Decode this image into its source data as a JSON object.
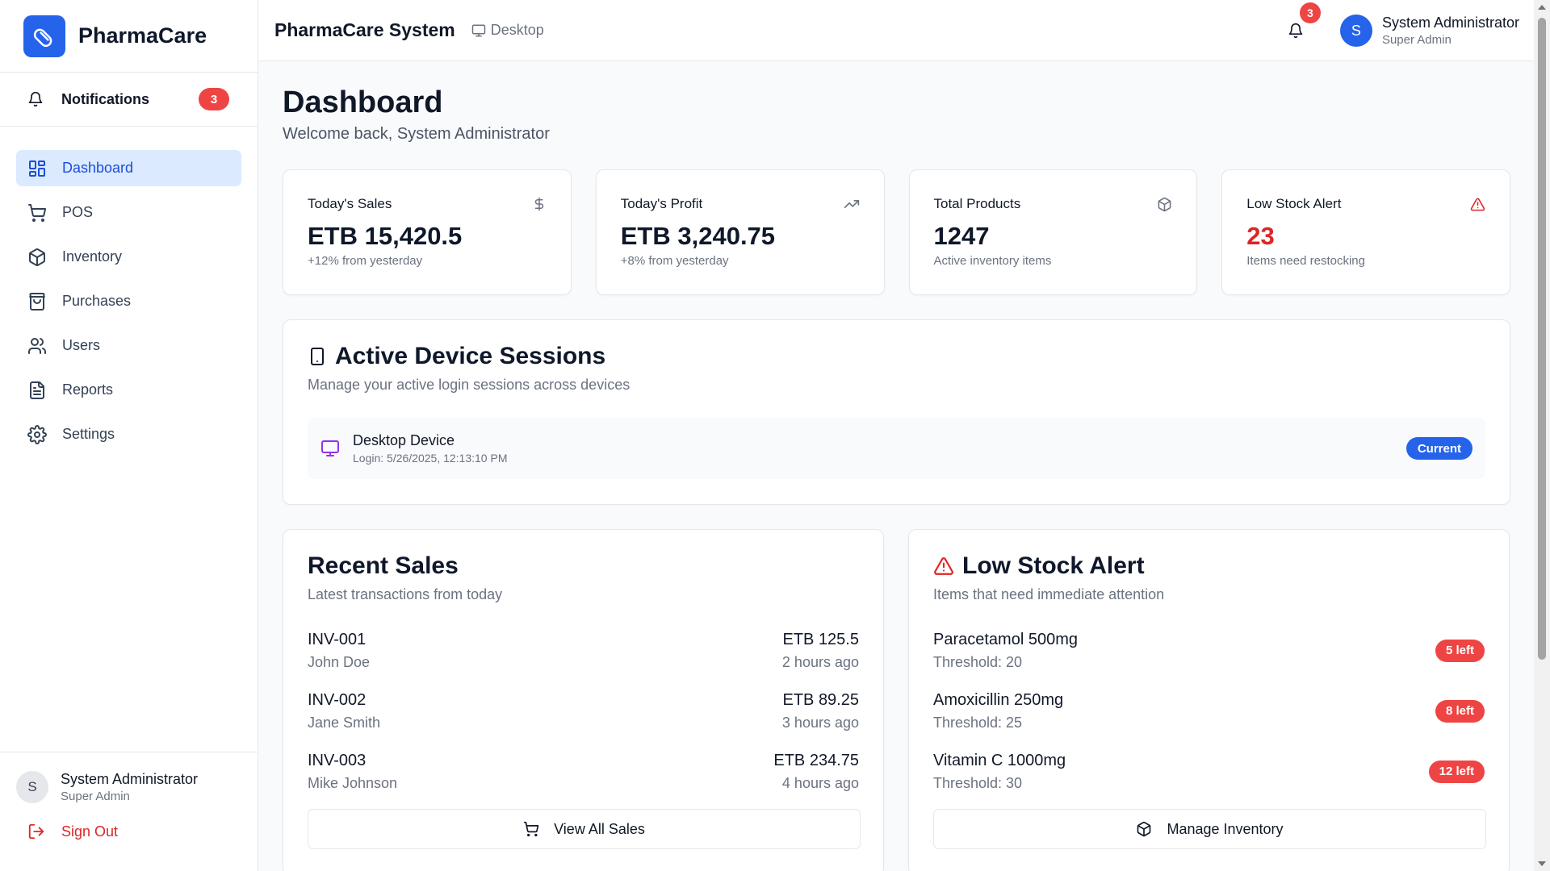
{
  "brand": {
    "name": "PharmaCare"
  },
  "sidebar": {
    "notifications": {
      "label": "Notifications",
      "count": "3"
    },
    "items": [
      {
        "label": "Dashboard",
        "icon": "dashboard-grid-icon",
        "active": true
      },
      {
        "label": "POS",
        "icon": "cart-icon"
      },
      {
        "label": "Inventory",
        "icon": "package-icon"
      },
      {
        "label": "Purchases",
        "icon": "shopping-bag-icon"
      },
      {
        "label": "Users",
        "icon": "users-icon"
      },
      {
        "label": "Reports",
        "icon": "file-text-icon"
      },
      {
        "label": "Settings",
        "icon": "gear-icon"
      }
    ],
    "user": {
      "initial": "S",
      "name": "System Administrator",
      "role": "Super Admin"
    },
    "signout": "Sign Out"
  },
  "header": {
    "title": "PharmaCare System",
    "device": "Desktop",
    "notification_count": "3",
    "user": {
      "initial": "S",
      "name": "System Administrator",
      "role": "Super Admin"
    }
  },
  "page": {
    "title": "Dashboard",
    "subtitle": "Welcome back, System Administrator"
  },
  "stats": [
    {
      "label": "Today's Sales",
      "value": "ETB 15,420.5",
      "note": "+12% from yesterday",
      "icon": "dollar-icon"
    },
    {
      "label": "Today's Profit",
      "value": "ETB 3,240.75",
      "note": "+8% from yesterday",
      "icon": "trending-up-icon"
    },
    {
      "label": "Total Products",
      "value": "1247",
      "note": "Active inventory items",
      "icon": "package-icon"
    },
    {
      "label": "Low Stock Alert",
      "value": "23",
      "note": "Items need restocking",
      "icon": "warning-icon"
    }
  ],
  "sessions": {
    "title": "Active Device Sessions",
    "subtitle": "Manage your active login sessions across devices",
    "device": {
      "name": "Desktop Device",
      "login": "Login: 5/26/2025, 12:13:10 PM",
      "badge": "Current"
    }
  },
  "recent_sales": {
    "title": "Recent Sales",
    "subtitle": "Latest transactions from today",
    "rows": [
      {
        "invoice": "INV-001",
        "customer": "John Doe",
        "amount": "ETB 125.5",
        "time": "2 hours ago"
      },
      {
        "invoice": "INV-002",
        "customer": "Jane Smith",
        "amount": "ETB 89.25",
        "time": "3 hours ago"
      },
      {
        "invoice": "INV-003",
        "customer": "Mike Johnson",
        "amount": "ETB 234.75",
        "time": "4 hours ago"
      }
    ],
    "button": "View All Sales"
  },
  "low_stock": {
    "title": "Low Stock Alert",
    "subtitle": "Items that need immediate attention",
    "rows": [
      {
        "name": "Paracetamol 500mg",
        "threshold": "Threshold: 20",
        "badge": "5 left"
      },
      {
        "name": "Amoxicillin 250mg",
        "threshold": "Threshold: 25",
        "badge": "8 left"
      },
      {
        "name": "Vitamin C 1000mg",
        "threshold": "Threshold: 30",
        "badge": "12 left"
      }
    ],
    "button": "Manage Inventory"
  },
  "colors": {
    "accent": "#2563eb",
    "active_bg": "#dbeafe",
    "danger": "#ef4444",
    "device_icon": "#9333ea"
  }
}
